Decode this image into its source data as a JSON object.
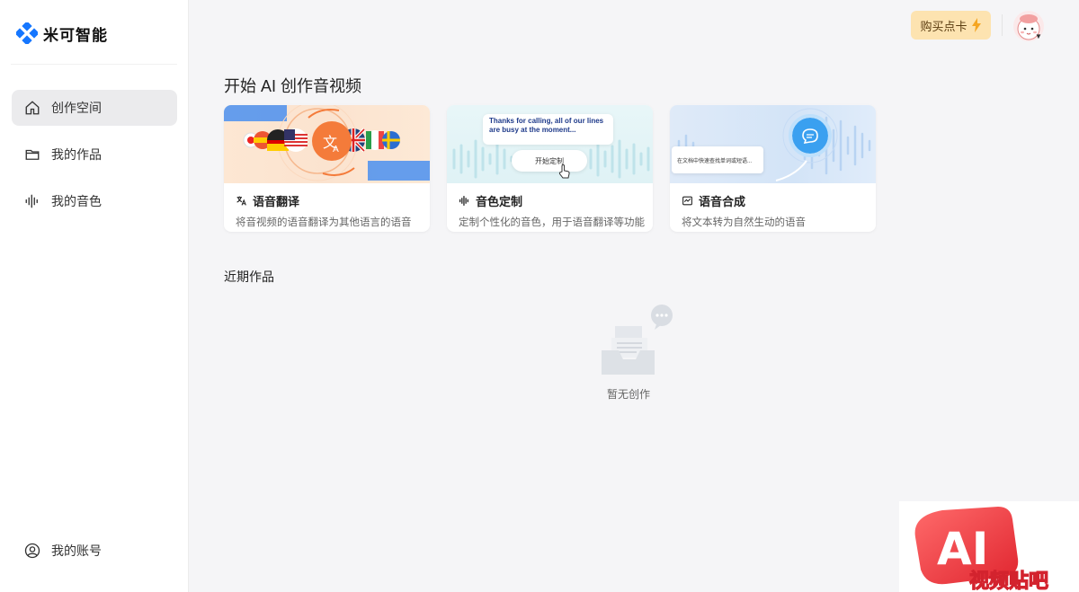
{
  "brand": {
    "name": "米可智能"
  },
  "sidebar": {
    "items": [
      {
        "label": "创作空间",
        "icon": "home-icon",
        "active": true
      },
      {
        "label": "我的作品",
        "icon": "folder-icon",
        "active": false
      },
      {
        "label": "我的音色",
        "icon": "waveform-icon",
        "active": false
      }
    ],
    "account_label": "我的账号"
  },
  "header": {
    "buy_label": "购买点卡",
    "buy_icon": "lightning-icon"
  },
  "main": {
    "title": "开始 AI 创作音视频",
    "cards": [
      {
        "title": "语音翻译",
        "desc": "将音视频的语音翻译为其他语言的语音",
        "icon": "translate-icon"
      },
      {
        "title": "音色定制",
        "desc": "定制个性化的音色，用于语音翻译等功能",
        "icon": "waveform-icon",
        "preview_text": "Thanks for calling, all of our lines are busy at the moment...",
        "preview_button": "开始定制"
      },
      {
        "title": "语音合成",
        "desc": "将文本转为自然生动的语音",
        "icon": "chart-icon",
        "preview_text": "在文档中快速查找单词或短语..."
      }
    ],
    "recent_title": "近期作品",
    "empty_text": "暂无创作"
  },
  "watermark": {
    "text_top": "AI",
    "text_bottom": "视频贴吧"
  },
  "colors": {
    "brand_blue": "#1677ff",
    "buy_bg": "#fde3b0",
    "accent_orange": "#f47b3a",
    "bolt": "#f5a623"
  }
}
